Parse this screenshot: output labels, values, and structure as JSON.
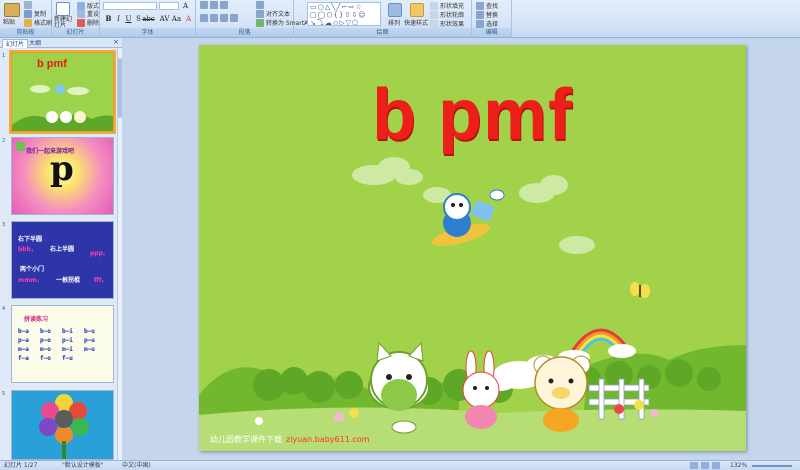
{
  "ribbon": {
    "groups": {
      "clipboard": "剪贴板",
      "slides": "幻灯片",
      "font": "字体",
      "paragraph": "段落",
      "drawing": "绘图",
      "editing": "编辑"
    },
    "clipboard": {
      "paste": "粘贴",
      "copy": "复制",
      "format_painter": "格式刷"
    },
    "slides": {
      "new_slide": "新建幻灯片",
      "layout": "版式",
      "reset": "重设",
      "delete": "删除"
    },
    "paragraph": {
      "align_text": "对齐文本",
      "smartart": "转换为 SmartArt"
    },
    "drawing": {
      "arrange": "排列",
      "quick_styles": "快速样式",
      "shape_fill": "形状填充",
      "shape_outline": "形状轮廓",
      "shape_effects": "形状效果"
    },
    "editing": {
      "find": "查找",
      "replace": "替换",
      "select": "选择"
    }
  },
  "pane": {
    "tab_slides": "幻灯片",
    "tab_outline": "大纲",
    "close": "×"
  },
  "thumbnails": [
    {
      "num": "1",
      "title": "b pmf"
    },
    {
      "num": "2",
      "heading": "我们一起来游戏吧",
      "letter": "p"
    },
    {
      "num": "3",
      "lines": [
        "右下半圆",
        "bbb，",
        "右上半圆",
        "ppp。",
        "两个小门",
        "mmm，",
        "一根拐棍",
        "fff。"
      ]
    },
    {
      "num": "4",
      "heading": "拼读练习",
      "cells": [
        "b–a",
        "b–o",
        "b–i",
        "b–u",
        "p–a",
        "p–o",
        "p–i",
        "p–u",
        "m–a",
        "m–o",
        "m–i",
        "m–u",
        "f–a",
        "f–o",
        "f–u"
      ]
    },
    {
      "num": "5"
    }
  ],
  "slide": {
    "title": "b pmf",
    "footer": "幼儿园教学课件下载",
    "url": "ziyuan.baby611.com"
  },
  "status": {
    "slide_info": "幻灯片 1/27",
    "theme": "\"默认设计模板\"",
    "language": "中文(中国)",
    "zoom": "132%"
  },
  "colors": {
    "slide_bg": "#a1d24a",
    "title": "#ec1f19",
    "ribbon": "#d6e5f7"
  }
}
